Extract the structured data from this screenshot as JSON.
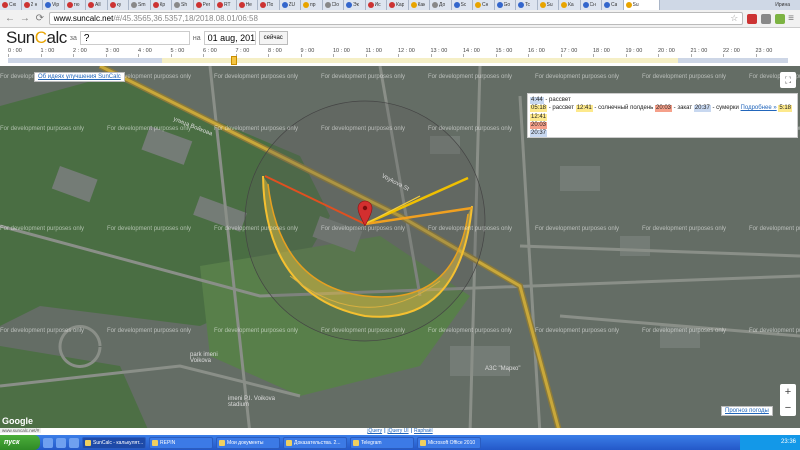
{
  "browser": {
    "tabs": [
      {
        "label": "Сю",
        "favicon": "#cc3333"
      },
      {
        "label": "2 н",
        "favicon": "#cc3333"
      },
      {
        "label": "Vip",
        "favicon": "#3366cc"
      },
      {
        "label": "тю",
        "favicon": "#cc3333"
      },
      {
        "label": "All",
        "favicon": "#cc3333"
      },
      {
        "label": "ку",
        "favicon": "#cc3333"
      },
      {
        "label": "Sm",
        "favicon": "#888888"
      },
      {
        "label": "Кр",
        "favicon": "#cc3333"
      },
      {
        "label": "Sh",
        "favicon": "#888888"
      },
      {
        "label": "Per",
        "favicon": "#cc3333"
      },
      {
        "label": "RT",
        "favicon": "#cc3333"
      },
      {
        "label": "Не",
        "favicon": "#cc3333"
      },
      {
        "label": "По",
        "favicon": "#cc3333"
      },
      {
        "label": "ZU",
        "favicon": "#3366cc"
      },
      {
        "label": "пр",
        "favicon": "#e8a400"
      },
      {
        "label": "Clo",
        "favicon": "#888888"
      },
      {
        "label": "Эк",
        "favicon": "#3366cc"
      },
      {
        "label": "Ис",
        "favicon": "#cc3333"
      },
      {
        "label": "Кар",
        "favicon": "#cc3333"
      },
      {
        "label": "Как",
        "favicon": "#e8a400"
      },
      {
        "label": "До",
        "favicon": "#888888"
      },
      {
        "label": "Sc",
        "favicon": "#3366cc"
      },
      {
        "label": "Сн",
        "favicon": "#e8a400"
      },
      {
        "label": "Go",
        "favicon": "#3366cc"
      },
      {
        "label": "Tc",
        "favicon": "#3366cc"
      },
      {
        "label": "Su",
        "favicon": "#e8a400"
      },
      {
        "label": "Ка",
        "favicon": "#e8a400"
      },
      {
        "label": "Сн",
        "favicon": "#3366cc"
      },
      {
        "label": "Ca",
        "favicon": "#3366cc"
      },
      {
        "label": "Su",
        "favicon": "#e8a400",
        "active": true
      }
    ],
    "profile": "Ирина",
    "url_host": "www.suncalc.net",
    "url_path": "/#/45.3565,36.5357,18/2018.08.01/06:58"
  },
  "app": {
    "logo_pre": "Sun",
    "logo_sun": "C",
    "logo_post": "alc",
    "place_label": "за",
    "place_value": "?",
    "date_label": "на",
    "date_value": "01 aug, 2018",
    "today_button": "сейчас"
  },
  "ruler": {
    "hours": [
      "0 : 00",
      "1 : 00",
      "2 : 00",
      "3 : 00",
      "4 : 00",
      "5 : 00",
      "6 : 00",
      "7 : 00",
      "8 : 00",
      "9 : 00",
      "10 : 00",
      "11 : 00",
      "12 : 00",
      "13 : 00",
      "14 : 00",
      "15 : 00",
      "16 : 00",
      "17 : 00",
      "18 : 00",
      "19 : 00",
      "20 : 00",
      "21 : 00",
      "22 : 00",
      "23 : 00"
    ],
    "selected_time": "06:58"
  },
  "map": {
    "improve_link": "Об идеях улучшения SunCalc",
    "watermark": "For development purposes only",
    "streets": {
      "vojkova": "улица Войкова",
      "vojkova_st": "Voykova St",
      "park": "park imeni Voikova",
      "stadium": "imeni P.I. Voikova stadium",
      "aza": "АЗС \"Марко\""
    },
    "forecast_link": "Прогноз погоды",
    "google": "Google",
    "terms": "Картографические данные © 2018 Google   Условия использования",
    "zoom_in": "+",
    "zoom_out": "−",
    "fullscreen": "⛶"
  },
  "info": {
    "twilight_start": "4:44",
    "twilight_start_label": "- рассвет",
    "sunrise": "05:18",
    "sunrise_label": "- рассвет",
    "solar_noon": "12:41",
    "solar_noon_label": "- солнечный полдень",
    "sunset": "20:03",
    "sunset_label": "- закат",
    "dusk": "20:37",
    "dusk_label": "- сумерки",
    "details_link": "Подробнее »",
    "day_length": "5:18",
    "row2": "12:41",
    "row3": "20:03",
    "row4": "20:37"
  },
  "credits": {
    "jquery": "jQuery",
    "jqueryui": "jQuery UI",
    "raphael": "Raphaël",
    "sep": "|",
    "status_url": "www.suncalc.net/#"
  },
  "taskbar": {
    "start": "пуск",
    "tasks": [
      {
        "label": "SunCalc - калькулят...",
        "active": true
      },
      {
        "label": "REPIN",
        "active": false
      },
      {
        "label": "Мои документы",
        "active": false
      },
      {
        "label": "Доказательства. 2...",
        "active": false
      },
      {
        "label": "Telegram",
        "active": false
      },
      {
        "label": "Microsoft Office 2010",
        "active": false
      }
    ],
    "clock": "23:36"
  },
  "colors": {
    "sunrise_line": "#f0a020",
    "sunset_line": "#e05020",
    "noon_line": "#f0c000",
    "sun_path": "#f5c030",
    "marker": "#d32f2f"
  }
}
